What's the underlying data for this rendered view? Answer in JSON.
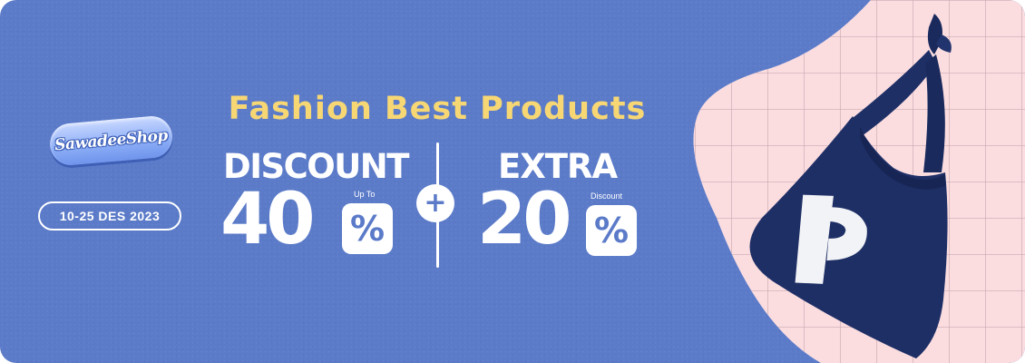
{
  "banner": {
    "brand": "SawadeeShop",
    "date_range": "10-25 DES 2023",
    "headline": "Fashion Best Products",
    "offer_left": {
      "label": "DISCOUNT",
      "small_label": "Up To",
      "value": "40",
      "percent_sign": "%"
    },
    "offer_right": {
      "label": "EXTRA",
      "small_label": "Discount",
      "value": "20",
      "percent_sign": "%"
    },
    "plus_symbol": "+"
  },
  "colors": {
    "background_blue": "#5b7bc9",
    "headline_yellow": "#f7d774",
    "panel_pink": "#fbdde0",
    "grid_line": "#c9a9b2",
    "bag_navy": "#1e2f66",
    "text_white": "#ffffff"
  },
  "icons": {
    "product_image": "tote-bag-icon",
    "plus": "plus-icon"
  }
}
